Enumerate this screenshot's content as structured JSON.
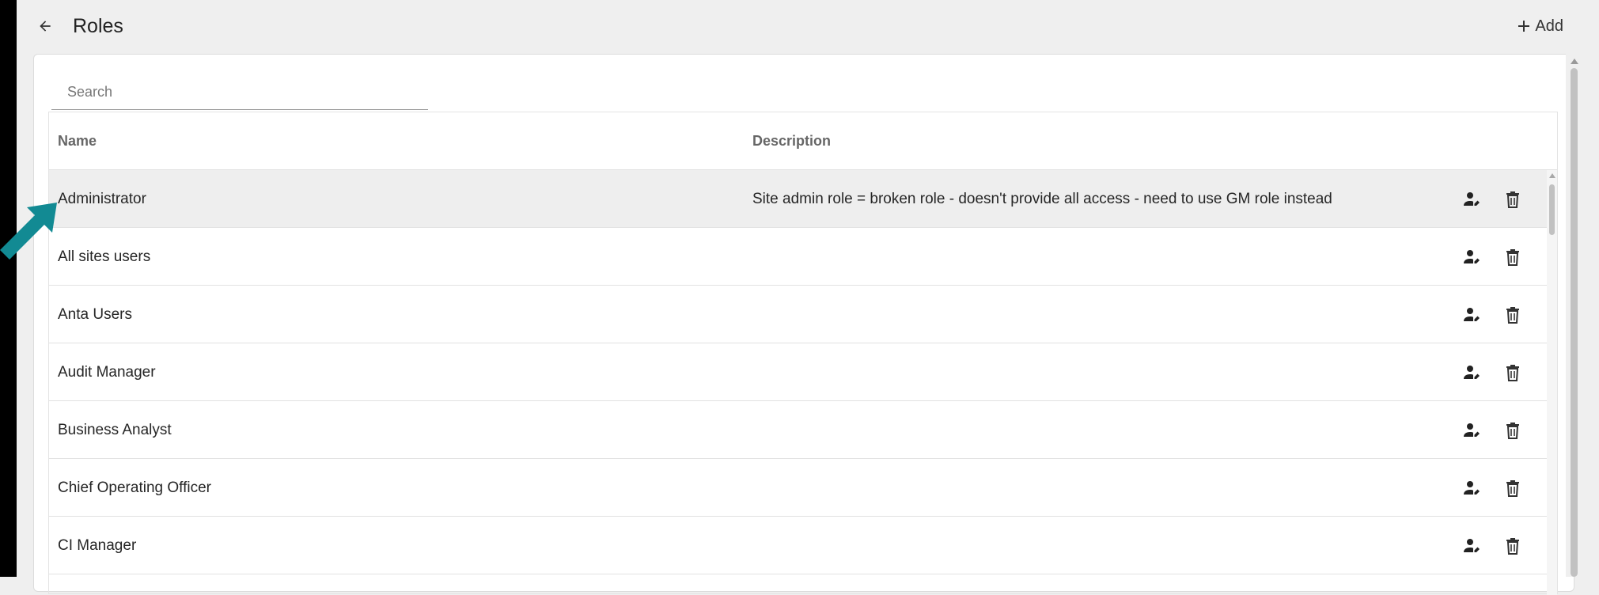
{
  "header": {
    "title": "Roles",
    "add_label": "Add"
  },
  "search": {
    "placeholder": "Search",
    "value": ""
  },
  "table": {
    "columns": [
      "Name",
      "Description"
    ],
    "rows": [
      {
        "name": "Administrator",
        "description": "Site admin role = broken role - doesn't provide all access - need to use GM role instead",
        "selected": true
      },
      {
        "name": "All sites users",
        "description": ""
      },
      {
        "name": "Anta Users",
        "description": ""
      },
      {
        "name": "Audit Manager",
        "description": ""
      },
      {
        "name": "Business Analyst",
        "description": ""
      },
      {
        "name": "Chief Operating Officer",
        "description": ""
      },
      {
        "name": "CI Manager",
        "description": ""
      }
    ]
  },
  "icons": {
    "back": "arrow-back-icon",
    "add": "plus-icon",
    "assign_users": "user-edit-icon",
    "delete": "trash-icon"
  },
  "colors": {
    "annotation_arrow": "#128a93",
    "selected_row": "#eeeeee"
  }
}
